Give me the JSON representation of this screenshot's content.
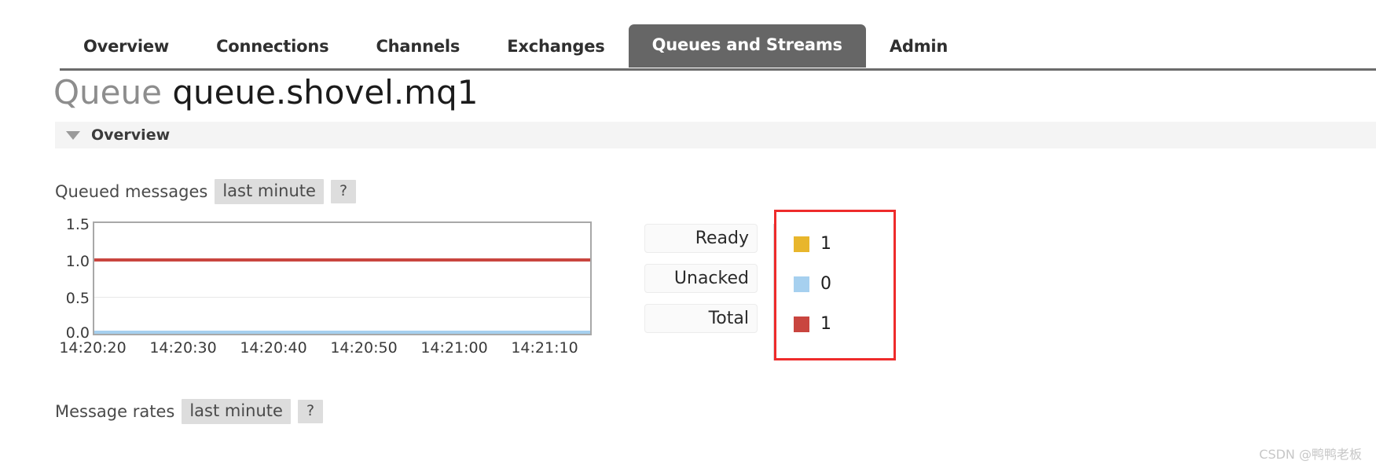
{
  "nav": {
    "tabs": [
      {
        "label": "Overview",
        "active": false
      },
      {
        "label": "Connections",
        "active": false
      },
      {
        "label": "Channels",
        "active": false
      },
      {
        "label": "Exchanges",
        "active": false
      },
      {
        "label": "Queues and Streams",
        "active": true
      },
      {
        "label": "Admin",
        "active": false
      }
    ]
  },
  "page": {
    "title_label": "Queue",
    "title_name": "queue.shovel.mq1"
  },
  "overview_section": {
    "title": "Overview",
    "collapse_icon": "triangle-down-icon"
  },
  "queued_messages": {
    "heading": "Queued messages",
    "period": "last minute",
    "help": "?"
  },
  "message_rates": {
    "heading": "Message rates",
    "period": "last minute",
    "help": "?"
  },
  "stats": {
    "rows": [
      {
        "label": "Ready",
        "value": "1",
        "color": "#e8b62c"
      },
      {
        "label": "Unacked",
        "value": "0",
        "color": "#a6d0ef"
      },
      {
        "label": "Total",
        "value": "1",
        "color": "#c9453f"
      }
    ],
    "highlight_color": "#ee2b2b"
  },
  "watermark": "CSDN @鸭鸭老板",
  "chart_data": {
    "type": "line",
    "title": "Queued messages",
    "xlabel": "",
    "ylabel": "",
    "ylim": [
      0.0,
      1.5
    ],
    "yticks": [
      0.0,
      0.5,
      1.0,
      1.5
    ],
    "ytick_labels": [
      "0.0",
      "0.5",
      "1.0",
      "1.5"
    ],
    "x": [
      "14:20:20",
      "14:20:30",
      "14:20:40",
      "14:20:50",
      "14:21:00",
      "14:21:10"
    ],
    "xtick_labels": [
      "14:20:20",
      "14:20:30",
      "14:20:40",
      "14:20:50",
      "14:21:00",
      "14:21:10"
    ],
    "grid": true,
    "legend_position": "right",
    "series": [
      {
        "name": "Total",
        "color": "#c9453f",
        "values": [
          1,
          1,
          1,
          1,
          1,
          1
        ]
      },
      {
        "name": "Unacked",
        "color": "#a6d0ef",
        "values": [
          0,
          0,
          0,
          0,
          0,
          0
        ]
      }
    ]
  }
}
